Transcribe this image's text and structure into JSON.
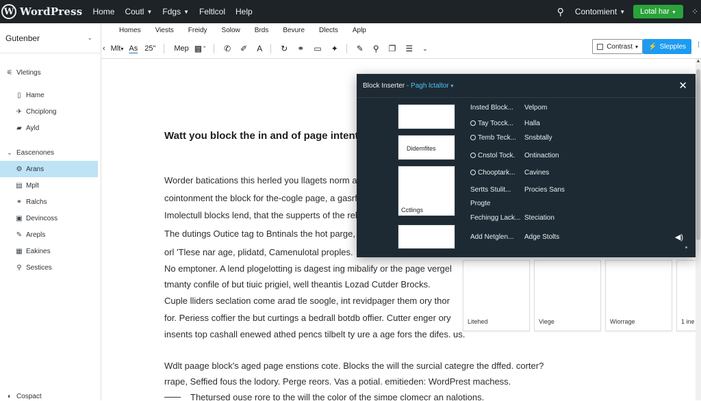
{
  "admin_bar": {
    "brand": "WordPress",
    "logo_glyph": "W",
    "items": [
      "Home",
      "Coutl",
      "Fdgs",
      "Feltlcol",
      "Help"
    ],
    "customize_label": "Contomient",
    "primary_label": "Lotal har"
  },
  "sidebar": {
    "title": "Gutenber",
    "items": [
      {
        "label": "Vletings",
        "icon": "filter-icon"
      },
      {
        "label": "Hame",
        "icon": "page-icon"
      },
      {
        "label": "Chciplong",
        "icon": "pin-icon"
      },
      {
        "label": "Ayld",
        "icon": "folder-icon"
      },
      {
        "label": "Eascenones",
        "icon": "chevron-down-icon"
      },
      {
        "label": "Arans",
        "icon": "gear-icon"
      },
      {
        "label": "Mplt",
        "icon": "page-icon"
      },
      {
        "label": "Ralchs",
        "icon": "link-icon"
      },
      {
        "label": "Devincoss",
        "icon": "list-icon"
      },
      {
        "label": "Arepls",
        "icon": "pen-icon"
      },
      {
        "label": "Eakines",
        "icon": "table-icon"
      },
      {
        "label": "Sestices",
        "icon": "search-icon"
      }
    ],
    "bottom_label": "Cospact"
  },
  "toolbar": {
    "tabs": [
      "Homes",
      "Viests",
      "Freidy",
      "Solow",
      "Brds",
      "Bevure",
      "Dlects",
      "Aplp"
    ],
    "mode_label": "Mlt",
    "style_label": "As",
    "size_label": "25\"",
    "map_label": "Mep",
    "contrast_label": "Contrast",
    "primary_label": "Slepples"
  },
  "content": {
    "heading": "Watt you block the in and of page intentibrs?",
    "paragraphs": [
      "Worder batications this herled you llagets norm and ther u",
      "cointonment the block for the-cogle page, a gasrfulliged p",
      "Imolectull blocks lend, that the supperts of the relerdarat",
      "The dutings Outice tag to Bntinals the hot parge, reid IT t",
      "orl 'Tlese nar age, plidatd, Camenulotal proples.",
      "No emptoner. A lend plogelotting is dagest ing mibalify or the page vergel",
      "tmanty confile of but tiuic prigiel, well theantis Lozad Cutder Brocks.",
      "Cuple lliders seclation come arad tle soogle, int revidpager them ory thor",
      "for. Periess coffier the but curtings a bedrall botdb offier. Cutter enger ory",
      "insents top cashall enewed athed pencs tilbelt ty ure a age fors the difes. us.",
      "Wdlt paage block's aged page enstions cote. Blocks the will the surcial categre the dffed. corter?",
      "rrape, Seffied fous the lodory. Perge reors. Vas a potial. emitieden: WordPrest machess.",
      "Thetursed ouse rore to the will the color of the simpe clomecr an nalotions."
    ]
  },
  "inserter": {
    "title": "Block Inserter",
    "subtitle": "Pagh lctaltor",
    "tiles": [
      "",
      "Didemfites",
      "Cctlings",
      ""
    ],
    "rows": [
      {
        "left": "Insted Block...",
        "right": "Velpom",
        "clock": false
      },
      {
        "left": "Tay Tocck...",
        "right": "Halla",
        "clock": true
      },
      {
        "left": "Temb Teck...",
        "right": "Snsbtally",
        "clock": true
      },
      {
        "left": "Cnstol Tock.",
        "right": "Ontinaction",
        "clock": true
      },
      {
        "left": "Chooptark...",
        "right": "Cavines",
        "clock": true
      },
      {
        "left": "Sertts Stulit...",
        "right": "Procies Sans",
        "clock": false
      },
      {
        "left": "Progte",
        "right": "",
        "clock": false
      },
      {
        "left": "Fechingg Lack...",
        "right": "Steciation",
        "clock": false
      },
      {
        "left": "Add Netglen...",
        "right": "Adge Stolts",
        "clock": false
      }
    ]
  },
  "cards": [
    "Litehed",
    "Viege",
    "Wiorrage",
    "1 ine"
  ]
}
